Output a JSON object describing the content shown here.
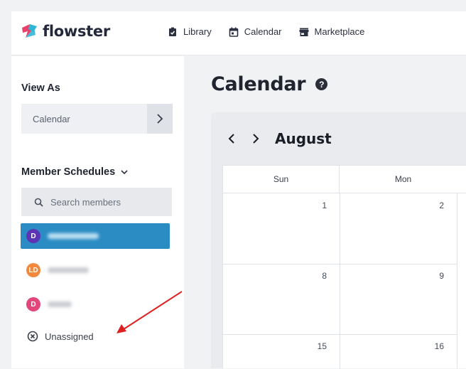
{
  "app": {
    "logo_text": "flowster",
    "brand_colors": [
      "#e8416a",
      "#2fb6d6"
    ]
  },
  "nav": [
    {
      "label": "Library",
      "icon": "clipboard-check-icon"
    },
    {
      "label": "Calendar",
      "icon": "calendar-icon"
    },
    {
      "label": "Marketplace",
      "icon": "store-icon"
    }
  ],
  "sidebar": {
    "view_as_title": "View As",
    "view_as_value": "Calendar",
    "members_title": "Member Schedules",
    "search_placeholder": "Search members",
    "members": [
      {
        "initials": "D",
        "color": "#5b35b5",
        "active": true
      },
      {
        "initials": "LD",
        "color": "#f0883e",
        "active": false
      },
      {
        "initials": "D",
        "color": "#e2467a",
        "active": false
      }
    ],
    "unassigned_label": "Unassigned"
  },
  "main": {
    "title": "Calendar",
    "help_icon": "question-circle-icon",
    "month": "August",
    "weekdays": [
      "Sun",
      "Mon"
    ],
    "weeks": [
      [
        "1",
        "2"
      ],
      [
        "8",
        "9"
      ],
      [
        "15",
        "16"
      ]
    ]
  },
  "annotation": {
    "arrow_color": "#e02020"
  }
}
